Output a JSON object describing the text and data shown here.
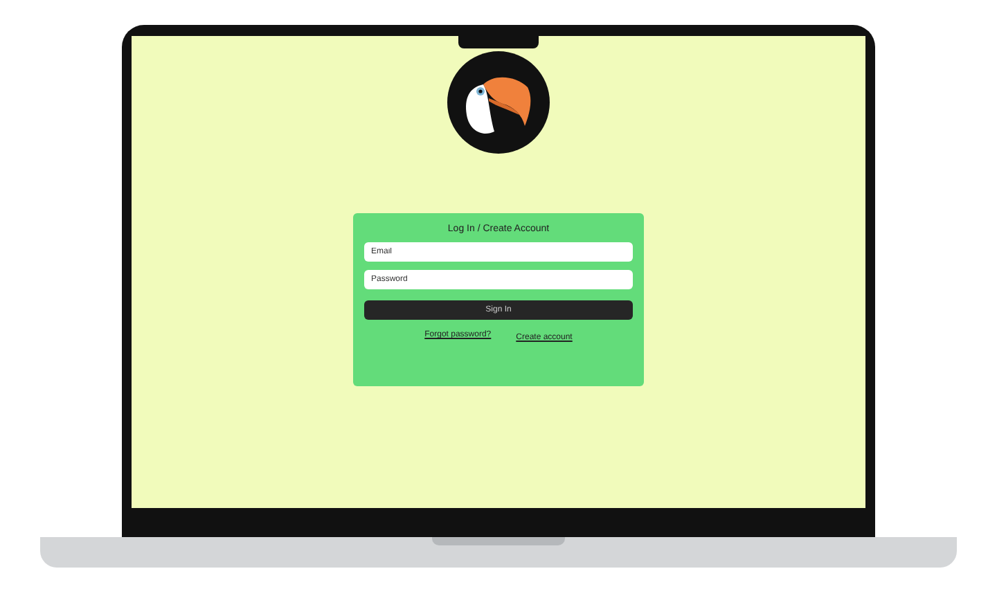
{
  "login_card": {
    "title": "Log In / Create Account",
    "fields": [
      {
        "placeholder": "Email"
      },
      {
        "placeholder": "Password"
      }
    ],
    "submit_button": "Sign In",
    "links": [
      "Forgot password?",
      "Create account"
    ]
  }
}
